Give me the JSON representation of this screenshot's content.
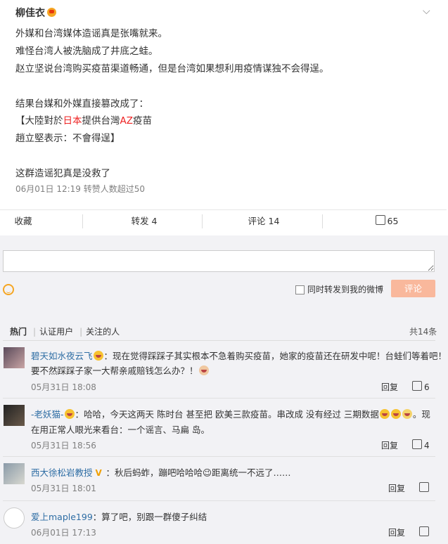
{
  "post": {
    "author": "柳佳衣",
    "lines": [
      "外媒和台湾媒体造谣真是张嘴就来。",
      "难怪台湾人被洗脑成了井底之蛙。",
      "赵立坚说台湾购买疫苗渠道畅通，但是台湾如果想利用疫情谋独不会得逞。",
      "结果台媒和外媒直接篡改成了："
    ],
    "quote1_pre": "【大陸對於",
    "quote1_red1": "日本",
    "quote1_mid": "提供台灣",
    "quote1_red2": "AZ",
    "quote1_post": "疫苗",
    "quote2": "趙立堅表示：不會得逞】",
    "closing": "这群造谣犯真是没救了",
    "meta": "06月01日 12:19 转赞人数超过50",
    "actions": {
      "collect": "收藏",
      "repost": "转发 4",
      "comment": "评论 14",
      "like": "65"
    }
  },
  "composer": {
    "placeholder": "",
    "forward_label": "同时转发到我的微博",
    "submit": "评论"
  },
  "comment_tabs": {
    "tabs": [
      "热门",
      "认证用户",
      "关注的人"
    ],
    "total": "共14条"
  },
  "comments": [
    {
      "name": "碧天如水夜云飞",
      "text1": "：现在觉得踩踩子其实根本不急着购买疫苗，她家的疫苗还在研发中呢！台蛙们等着吧！",
      "text2": "要不然踩踩子家一大帮亲戚赔钱怎么办？！",
      "time": "05月31日 18:08",
      "reply": "回复",
      "likes": "6"
    },
    {
      "name": "-老妖猫-",
      "text1": "：哈哈，今天这两天 陈时台 甚至把 欧美三款疫苗。串改成 没有经过 三期数据",
      "text1b": "。现",
      "text2": "在用正常人眼光来看台：一个谣言、马扁 岛。",
      "time": "05月31日 18:56",
      "reply": "回复",
      "likes": "4"
    },
    {
      "name": "西大徐松岩教授",
      "text1": "：秋后蚂蚱，蹦吧哈哈哈😉距离统一不远了……",
      "time": "05月31日 18:01",
      "reply": "回复",
      "likes": ""
    },
    {
      "name": "爱上maple199",
      "text1": "：算了吧，别跟一群傻子纠结",
      "time": "06月01日 17:13",
      "reply": "回复",
      "likes": ""
    }
  ]
}
